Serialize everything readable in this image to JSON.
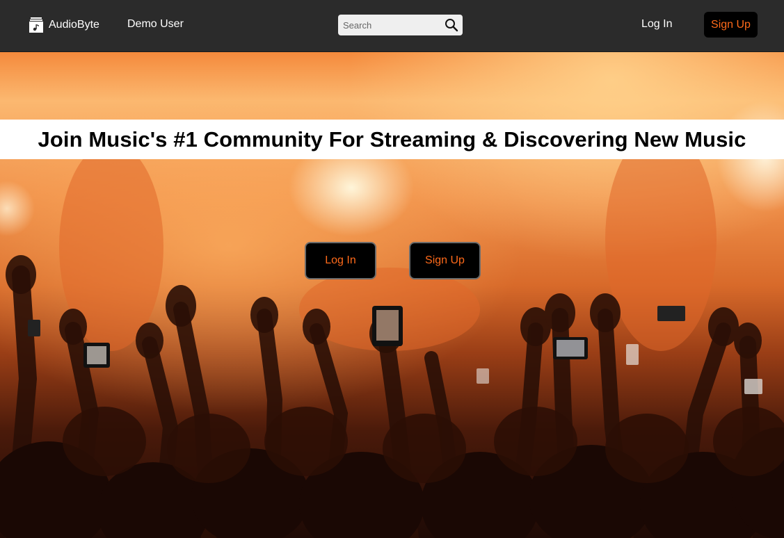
{
  "header": {
    "brand": "AudioByte",
    "demo_user": "Demo User",
    "search_placeholder": "Search",
    "login_label": "Log In",
    "signup_label": "Sign Up"
  },
  "hero": {
    "headline": "Join Music's #1 Community For Streaming & Discovering New Music",
    "login_label": "Log In",
    "signup_label": "Sign Up"
  },
  "icons": {
    "logo": "music-file-icon",
    "search": "search-icon"
  },
  "colors": {
    "navbar_bg": "#2b2b2b",
    "accent": "#ff6a1a",
    "button_bg": "#000000"
  }
}
